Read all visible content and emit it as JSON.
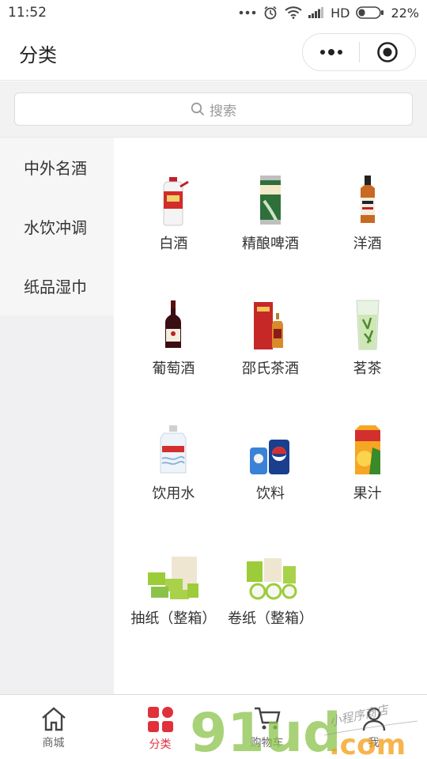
{
  "status_bar": {
    "time": "11:52",
    "network": "HD",
    "battery": "22%"
  },
  "header": {
    "title": "分类"
  },
  "search": {
    "placeholder": "搜索"
  },
  "sidebar": {
    "items": [
      {
        "label": "中外名酒"
      },
      {
        "label": "水饮冲调"
      },
      {
        "label": "纸品湿巾"
      }
    ]
  },
  "categories": [
    {
      "label": "白酒",
      "icon": "baijiu-bottle-icon"
    },
    {
      "label": "精酿啤酒",
      "icon": "beer-can-icon"
    },
    {
      "label": "洋酒",
      "icon": "whiskey-bottle-icon"
    },
    {
      "label": "葡萄酒",
      "icon": "wine-bottle-icon"
    },
    {
      "label": "邵氏茶酒",
      "icon": "tea-liquor-gift-box-icon"
    },
    {
      "label": "茗茶",
      "icon": "tea-glass-icon"
    },
    {
      "label": "饮用水",
      "icon": "water-jug-icon"
    },
    {
      "label": "饮料",
      "icon": "soda-cans-icon"
    },
    {
      "label": "果汁",
      "icon": "juice-carton-icon"
    },
    {
      "label": "抽纸（整箱）",
      "icon": "tissue-box-icon"
    },
    {
      "label": "卷纸（整箱）",
      "icon": "toilet-roll-icon"
    }
  ],
  "tabbar": {
    "items": [
      {
        "label": "商城",
        "icon": "home-icon",
        "active": false
      },
      {
        "label": "分类",
        "icon": "category-icon",
        "active": true
      },
      {
        "label": "购物车",
        "icon": "cart-icon",
        "active": false
      },
      {
        "label": "我",
        "icon": "user-icon",
        "active": false
      }
    ]
  },
  "watermark": {
    "brand": "91ud",
    "domain": ".com",
    "slogan": "小程序商店"
  },
  "colors": {
    "accent": "#e0313b",
    "sidebar_bg": "#f0f0f3",
    "watermark_green": "#8bc34a"
  }
}
